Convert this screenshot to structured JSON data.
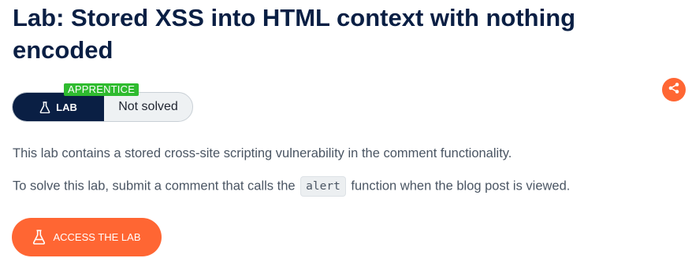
{
  "lab": {
    "title": "Lab: Stored XSS into HTML context with nothing encoded",
    "level": "APPRENTICE",
    "type_label": "LAB",
    "status": "Not solved"
  },
  "description": {
    "line1": "This lab contains a stored cross-site scripting vulnerability in the comment functionality.",
    "line2_before": "To solve this lab, submit a comment that calls the",
    "line2_code": "alert",
    "line2_after": "function when the blog post is viewed."
  },
  "actions": {
    "access_label": "ACCESS THE LAB",
    "share_icon": "share-icon"
  },
  "colors": {
    "navy": "#0a1f44",
    "orange": "#ff6633",
    "green": "#2fbb2f"
  }
}
